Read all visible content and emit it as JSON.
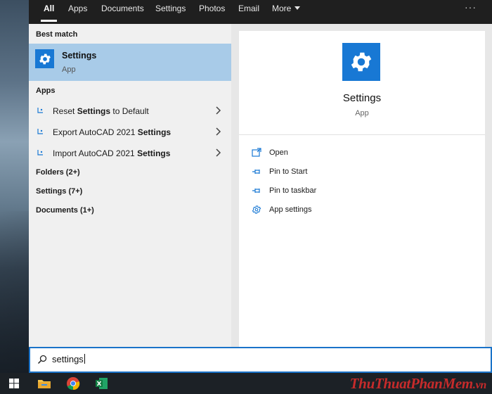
{
  "tabs": [
    {
      "label": "All",
      "active": true
    },
    {
      "label": "Apps"
    },
    {
      "label": "Documents"
    },
    {
      "label": "Settings"
    },
    {
      "label": "Photos"
    },
    {
      "label": "Email"
    },
    {
      "label": "More"
    }
  ],
  "more_menu": "···",
  "left": {
    "best_match_label": "Best match",
    "best_match": {
      "title": "Settings",
      "subtitle": "App",
      "icon": "gear-icon"
    },
    "apps_label": "Apps",
    "apps": [
      {
        "before": "Reset ",
        "bold": "Settings",
        "after": " to Default"
      },
      {
        "before": "Export AutoCAD 2021 ",
        "bold": "Settings",
        "after": ""
      },
      {
        "before": "Import AutoCAD 2021 ",
        "bold": "Settings",
        "after": ""
      }
    ],
    "groups": [
      "Folders (2+)",
      "Settings (7+)",
      "Documents (1+)"
    ]
  },
  "detail": {
    "title": "Settings",
    "subtitle": "App",
    "actions": [
      {
        "label": "Open",
        "icon": "open-icon"
      },
      {
        "label": "Pin to Start",
        "icon": "pin-icon"
      },
      {
        "label": "Pin to taskbar",
        "icon": "pin-icon"
      },
      {
        "label": "App settings",
        "icon": "gear-icon"
      }
    ]
  },
  "search": {
    "value": "settings"
  },
  "taskbar": {
    "items": [
      "windows-start-icon",
      "file-explorer-icon",
      "chrome-icon",
      "excel-icon"
    ]
  },
  "watermark": {
    "part1": "ThuThuat",
    "part2": "PhanMem",
    "part3": ".vn"
  },
  "colors": {
    "accent": "#1878d4",
    "selection": "#a8cbe8",
    "tabbar": "#1f1f1f",
    "watermark": "#c62b2b"
  }
}
